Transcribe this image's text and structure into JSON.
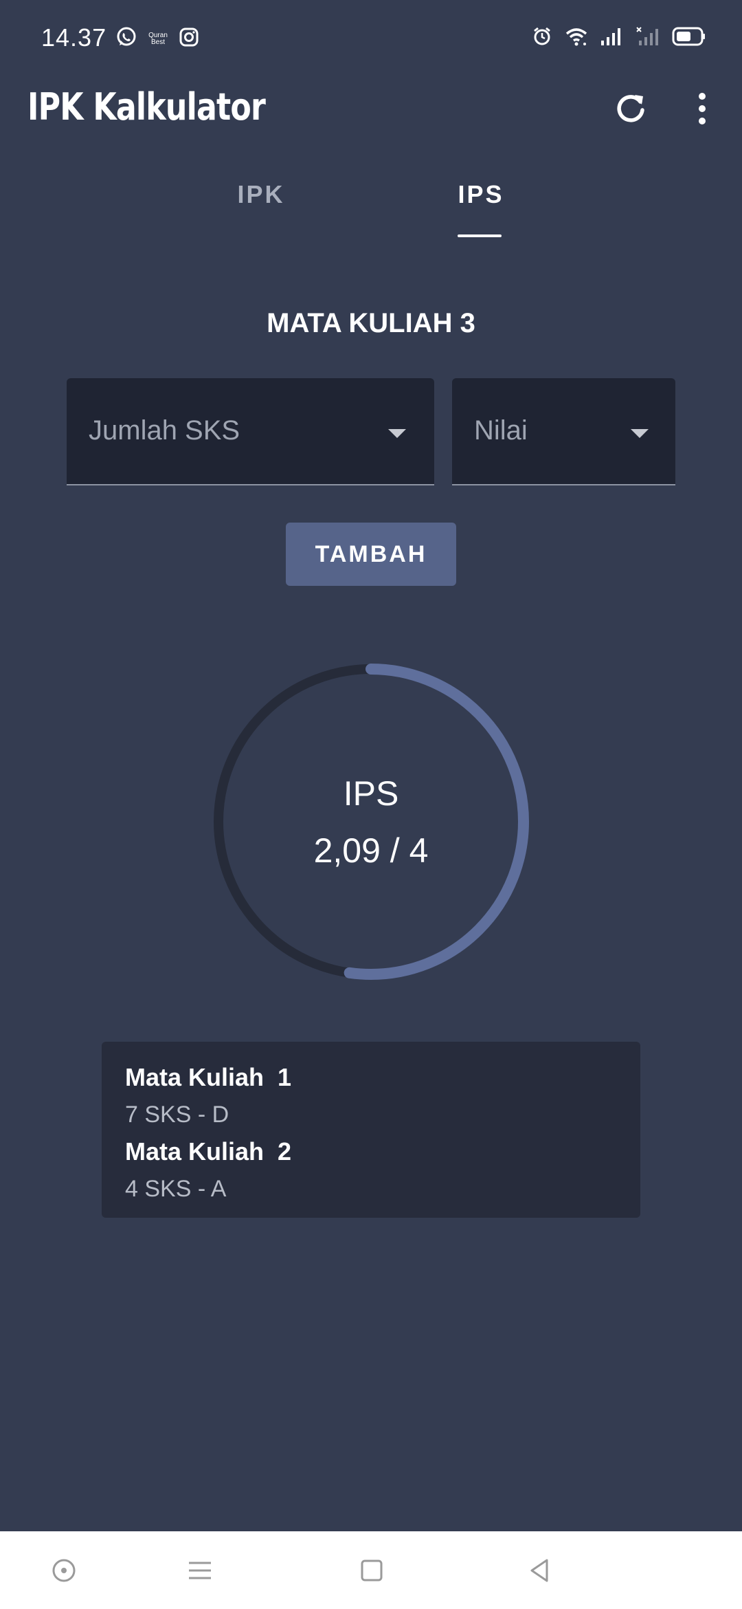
{
  "status_bar": {
    "time": "14.37",
    "app_icons": [
      "whatsapp-icon",
      "quran-best-icon",
      "instagram-icon"
    ],
    "quran_label_top": "Quran",
    "quran_label_bottom": "Best",
    "system_icons": [
      "alarm-icon",
      "wifi-icon",
      "signal-icon",
      "signal-no-service-icon",
      "battery-icon"
    ]
  },
  "app_bar": {
    "title": "IPK Kalkulator",
    "actions": [
      "refresh-icon",
      "more-vert-icon"
    ]
  },
  "tabs": [
    {
      "label": "IPK",
      "selected": false
    },
    {
      "label": "IPS",
      "selected": true
    }
  ],
  "form": {
    "title": "MATA KULIAH 3",
    "sks_dropdown": {
      "placeholder": "Jumlah SKS"
    },
    "nilai_dropdown": {
      "placeholder": "Nilai"
    },
    "add_button": "TAMBAH"
  },
  "result": {
    "label": "IPS",
    "value": "2,09 / 4",
    "progress_fraction": 0.5225
  },
  "courses": [
    {
      "name": "Mata Kuliah  1",
      "detail": "7 SKS - D"
    },
    {
      "name": "Mata Kuliah  2",
      "detail": "4 SKS - A"
    }
  ],
  "colors": {
    "background": "#343c51",
    "dropdown_bg": "#1f2433",
    "button_bg": "#56648a",
    "gauge_track": "#262b39",
    "gauge_fill": "#5f6f9c",
    "card_bg": "#272c3c"
  },
  "nav_bar": [
    "home-circle-icon",
    "menu-lines-icon",
    "square-icon",
    "back-triangle-icon"
  ]
}
